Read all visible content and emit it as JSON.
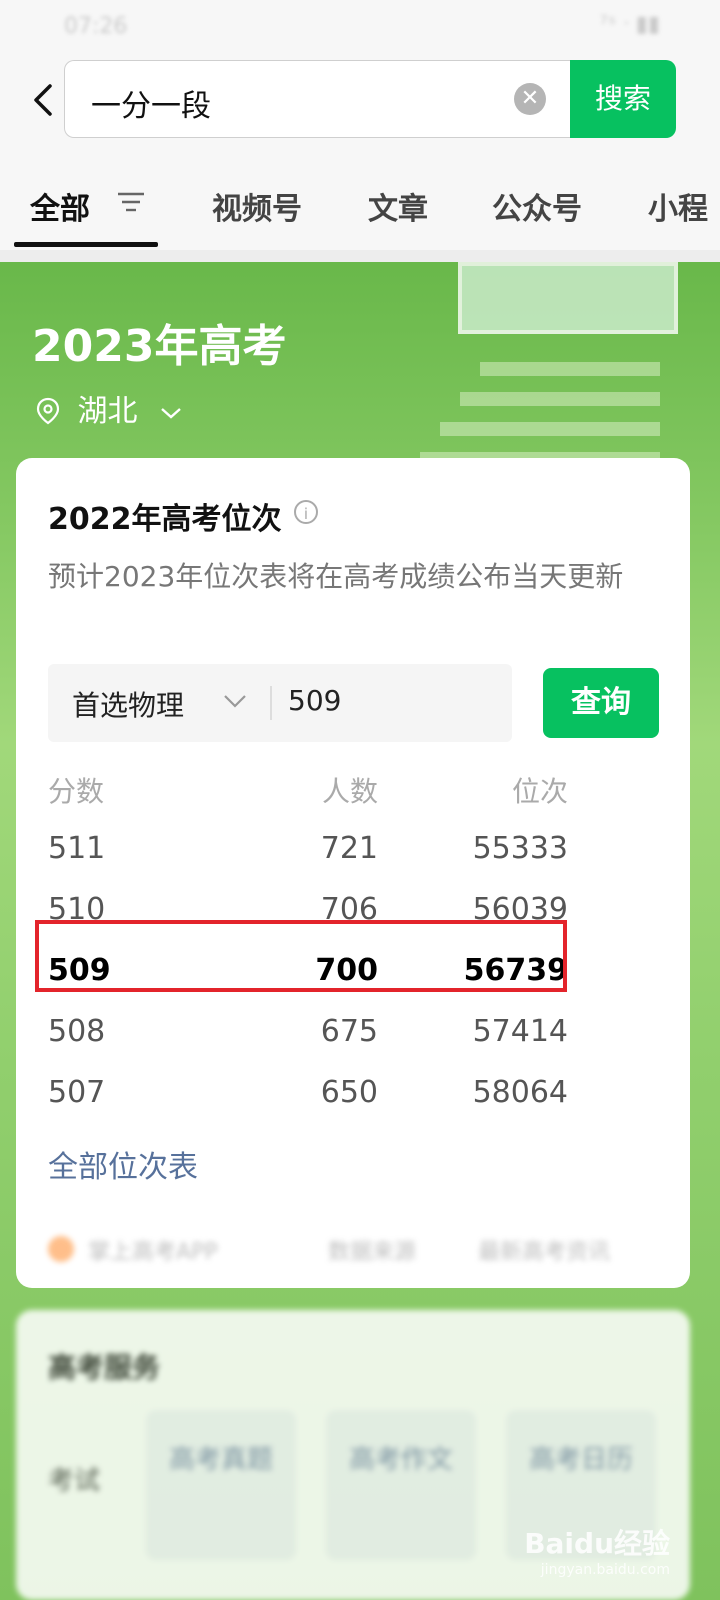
{
  "status_bar": {
    "time": "07:26",
    "icons": "⁷ˢ ᐧ ▮▮"
  },
  "search": {
    "query": "一分一段",
    "button": "搜索"
  },
  "tabs": [
    {
      "label": "全部"
    },
    {
      "label": "视频号"
    },
    {
      "label": "文章"
    },
    {
      "label": "公众号"
    },
    {
      "label": "小程"
    }
  ],
  "hero": {
    "title": "2023年高考",
    "location": "湖北"
  },
  "card": {
    "title": "2022年高考位次",
    "description": "预计2023年位次表将在高考成绩公布当天更新",
    "subject": "首选物理",
    "score": "509",
    "query_button": "查询",
    "table": {
      "headers": [
        "分数",
        "人数",
        "位次"
      ],
      "rows": [
        [
          "511",
          "721",
          "55333"
        ],
        [
          "510",
          "706",
          "56039"
        ],
        [
          "509",
          "700",
          "56739"
        ],
        [
          "508",
          "675",
          "57414"
        ],
        [
          "507",
          "650",
          "58064"
        ]
      ]
    },
    "all_link": "全部位次表",
    "footer_links": [
      "掌上高考APP",
      "数据来源",
      "最新高考资讯"
    ]
  },
  "card2": {
    "title": "高考服务",
    "label": "考试",
    "items": [
      "高考真题",
      "高考作文",
      "高考日历"
    ]
  },
  "watermark": {
    "brand": "Baidu经验",
    "url": "jingyan.baidu.com"
  },
  "colors": {
    "accent": "#07c160",
    "highlight_border": "#e3242b",
    "hero_green": "#86c963"
  }
}
